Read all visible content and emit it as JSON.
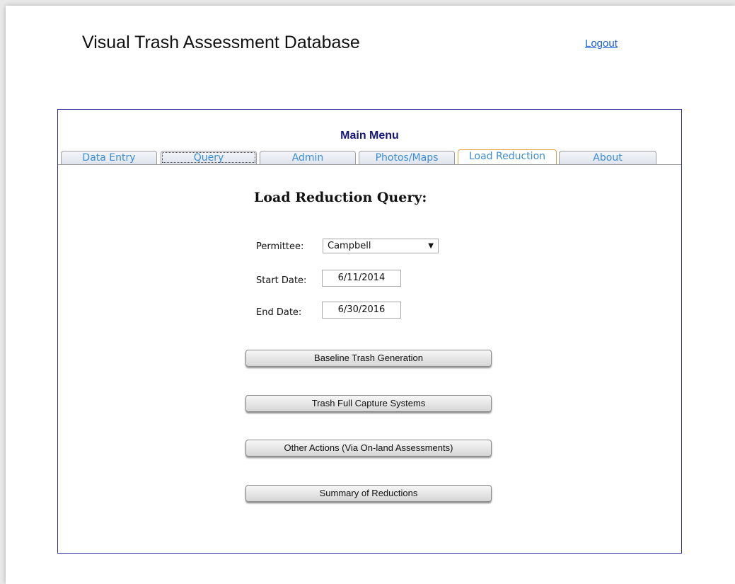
{
  "header": {
    "app_title": "Visual Trash Assessment Database",
    "logout_label": "Logout"
  },
  "menu": {
    "title": "Main Menu",
    "tabs": [
      {
        "label": "Data Entry"
      },
      {
        "label": "Query"
      },
      {
        "label": "Admin"
      },
      {
        "label": "Photos/Maps"
      },
      {
        "label": "Load Reduction"
      },
      {
        "label": "About"
      }
    ],
    "active_tab": "Load Reduction"
  },
  "form": {
    "title": "Load Reduction Query:",
    "permittee_label": "Permittee:",
    "permittee_value": "Campbell",
    "start_date_label": "Start Date:",
    "start_date_value": "6/11/2014",
    "end_date_label": "End Date:",
    "end_date_value": "6/30/2016"
  },
  "actions": [
    {
      "label": "Baseline Trash Generation"
    },
    {
      "label": "Trash Full Capture Systems"
    },
    {
      "label": "Other Actions (Via On-land Assessments)"
    },
    {
      "label": "Summary of Reductions"
    }
  ],
  "colors": {
    "panel_border": "#2c2ca8",
    "menu_title": "#14147f",
    "tab_text": "#3a8dd6",
    "active_tab_border": "#e8a23c",
    "link": "#1a5fd6"
  }
}
